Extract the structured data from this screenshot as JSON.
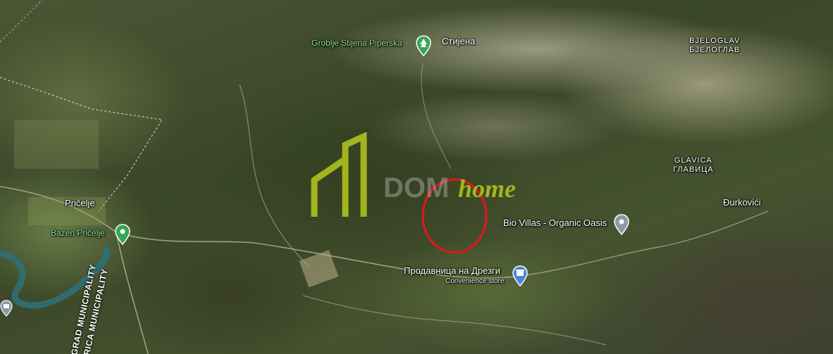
{
  "map": {
    "labels": {
      "stijena": "Стијена",
      "groblje": "Groblje Stijena Piperska",
      "bjeloglav_lat": "BJELOGLAV",
      "bjeloglav_cyr": "БЈЕЛОГЛАВ",
      "glavica_lat": "GLAVICA",
      "glavica_cyr": "ГЛАВИЦА",
      "durkovici": "Đurkovići",
      "pricelje": "Pričelje",
      "bazen": "Bazen Pričelje",
      "bio_villas": "Bio Villas - Organic Oasis",
      "prodavnica": "Продавница на Дрезги",
      "convenience": "Convenience store",
      "muni_1": "GRAD MUNICIPALITY",
      "muni_2": "RICA MUNICIPALITY"
    },
    "watermark": {
      "dom": "DOM",
      "home": "home"
    },
    "colors": {
      "marker_circle": "#e8141b",
      "pin_green": "#34a853",
      "pin_gray": "#8a9aa6",
      "pin_blue": "#4a86d4",
      "watermark_green": "#b5c81e"
    },
    "icons": [
      "park-pin-icon",
      "place-pin-icon",
      "shop-pin-icon",
      "museum-pin-icon"
    ]
  }
}
